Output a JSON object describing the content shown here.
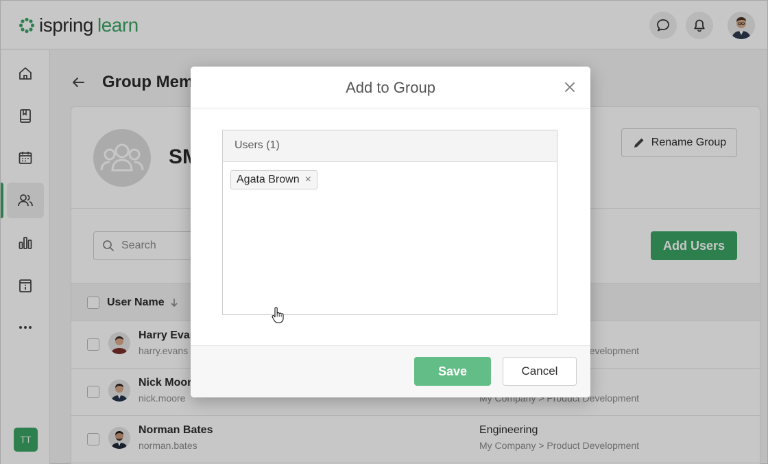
{
  "header": {
    "logo_brand": "ispring",
    "logo_product": "learn",
    "icons": [
      "chat-icon",
      "bell-icon",
      "user-avatar"
    ]
  },
  "sidebar": {
    "items": [
      {
        "name": "home",
        "icon": "home-icon"
      },
      {
        "name": "courses",
        "icon": "book-icon"
      },
      {
        "name": "calendar",
        "icon": "calendar-icon"
      },
      {
        "name": "groups",
        "icon": "users-icon",
        "active": true
      },
      {
        "name": "reports",
        "icon": "bar-chart-icon"
      },
      {
        "name": "info",
        "icon": "info-icon"
      },
      {
        "name": "more",
        "icon": "more-icon"
      }
    ],
    "user_initials": "TT"
  },
  "page": {
    "title": "Group Members",
    "group_name": "SMM",
    "rename_label": "Rename Group",
    "search_placeholder": "Search",
    "add_users_label": "Add Users",
    "column_user_name": "User Name"
  },
  "table": {
    "rows": [
      {
        "name": "Harry Evans",
        "login": "harry.evans",
        "department": "",
        "path": "My Company > Product Development"
      },
      {
        "name": "Nick Moore",
        "login": "nick.moore",
        "department": "",
        "path": "My Company > Product Development"
      },
      {
        "name": "Norman Bates",
        "login": "norman.bates",
        "department": "Engineering",
        "path": "My Company > Product Development"
      }
    ]
  },
  "modal": {
    "title": "Add to Group",
    "users_header": "Users (1)",
    "selected_users": [
      "Agata Brown"
    ],
    "save_label": "Save",
    "cancel_label": "Cancel"
  },
  "colors": {
    "accent": "#3aa564",
    "save_button": "#62be86"
  }
}
